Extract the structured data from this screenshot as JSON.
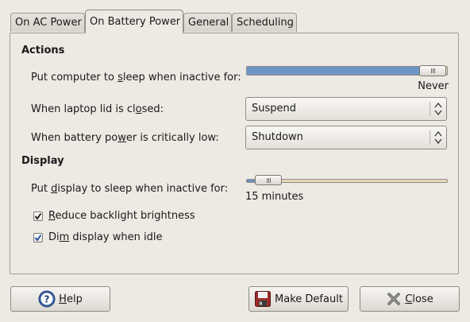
{
  "tabs": [
    {
      "label": "On AC Power"
    },
    {
      "label": "On Battery Power"
    },
    {
      "label": "General"
    },
    {
      "label": "Scheduling"
    }
  ],
  "actions": {
    "heading": "Actions",
    "sleep_label_pre": "Put computer to ",
    "sleep_label_mn": "s",
    "sleep_label_post": "leep when inactive for:",
    "sleep_value": "Never",
    "sleep_slider_fraction": 1.0,
    "lid_label_pre": "When laptop lid is cl",
    "lid_label_mn": "o",
    "lid_label_post": "sed:",
    "lid_value": "Suspend",
    "battery_label_pre": "When battery po",
    "battery_label_mn": "w",
    "battery_label_post": "er is critically low:",
    "battery_value": "Shutdown"
  },
  "display": {
    "heading": "Display",
    "sleep_label_pre": "Put ",
    "sleep_label_mn": "d",
    "sleep_label_post": "isplay to sleep when inactive for:",
    "sleep_value": "15 minutes",
    "sleep_slider_fraction": 0.05,
    "backlight_mn": "R",
    "backlight_rest": "educe backlight brightness",
    "backlight_checked": true,
    "dim_pre": "Di",
    "dim_mn": "m",
    "dim_post": " display when idle",
    "dim_checked": true
  },
  "buttons": {
    "help_mn": "H",
    "help_rest": "elp",
    "make_default": "Make Default",
    "close_mn": "C",
    "close_rest": "lose"
  },
  "colors": {
    "slider_fill": "#6e93c5",
    "checkbox_tick": "#1f4fa0"
  }
}
